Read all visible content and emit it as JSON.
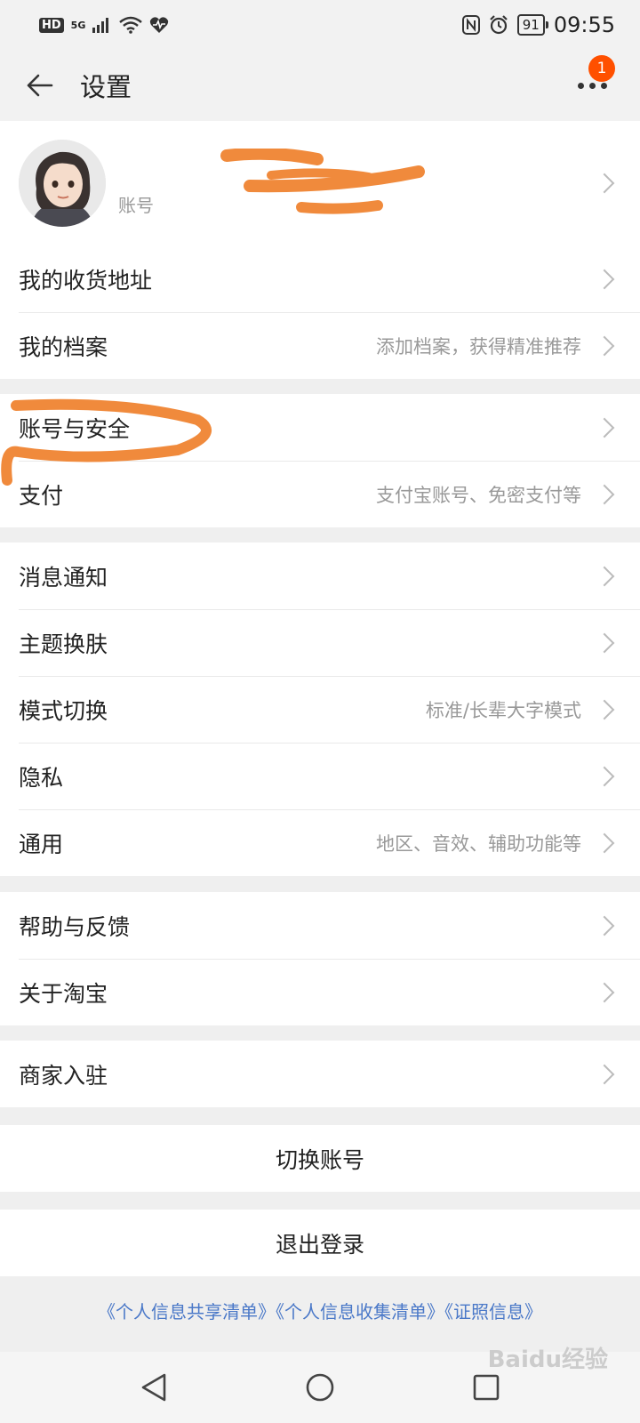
{
  "status_bar": {
    "left_badge": "HD",
    "network": "5G",
    "battery": "91",
    "time": "09:55"
  },
  "header": {
    "title": "设置",
    "notification_count": "1"
  },
  "profile": {
    "name": "",
    "account_label": "账号"
  },
  "group1": [
    {
      "label": "我的收货地址",
      "hint": ""
    },
    {
      "label": "我的档案",
      "hint": "添加档案，获得精准推荐"
    }
  ],
  "group2": [
    {
      "label": "账号与安全",
      "hint": ""
    },
    {
      "label": "支付",
      "hint": "支付宝账号、免密支付等"
    }
  ],
  "group3": [
    {
      "label": "消息通知",
      "hint": ""
    },
    {
      "label": "主题换肤",
      "hint": ""
    },
    {
      "label": "模式切换",
      "hint": "标准/长辈大字模式"
    },
    {
      "label": "隐私",
      "hint": ""
    },
    {
      "label": "通用",
      "hint": "地区、音效、辅助功能等"
    }
  ],
  "group4": [
    {
      "label": "帮助与反馈",
      "hint": ""
    },
    {
      "label": "关于淘宝",
      "hint": ""
    }
  ],
  "group5": [
    {
      "label": "商家入驻",
      "hint": ""
    }
  ],
  "buttons": {
    "switch_account": "切换账号",
    "logout": "退出登录"
  },
  "footer": {
    "links": "《个人信息共享清单》《个人信息收集清单》《证照信息》"
  },
  "watermark": "Baidu经验",
  "colors": {
    "accent": "#ff5000",
    "annotation": "#f08a3c",
    "link": "#4a78c8"
  }
}
